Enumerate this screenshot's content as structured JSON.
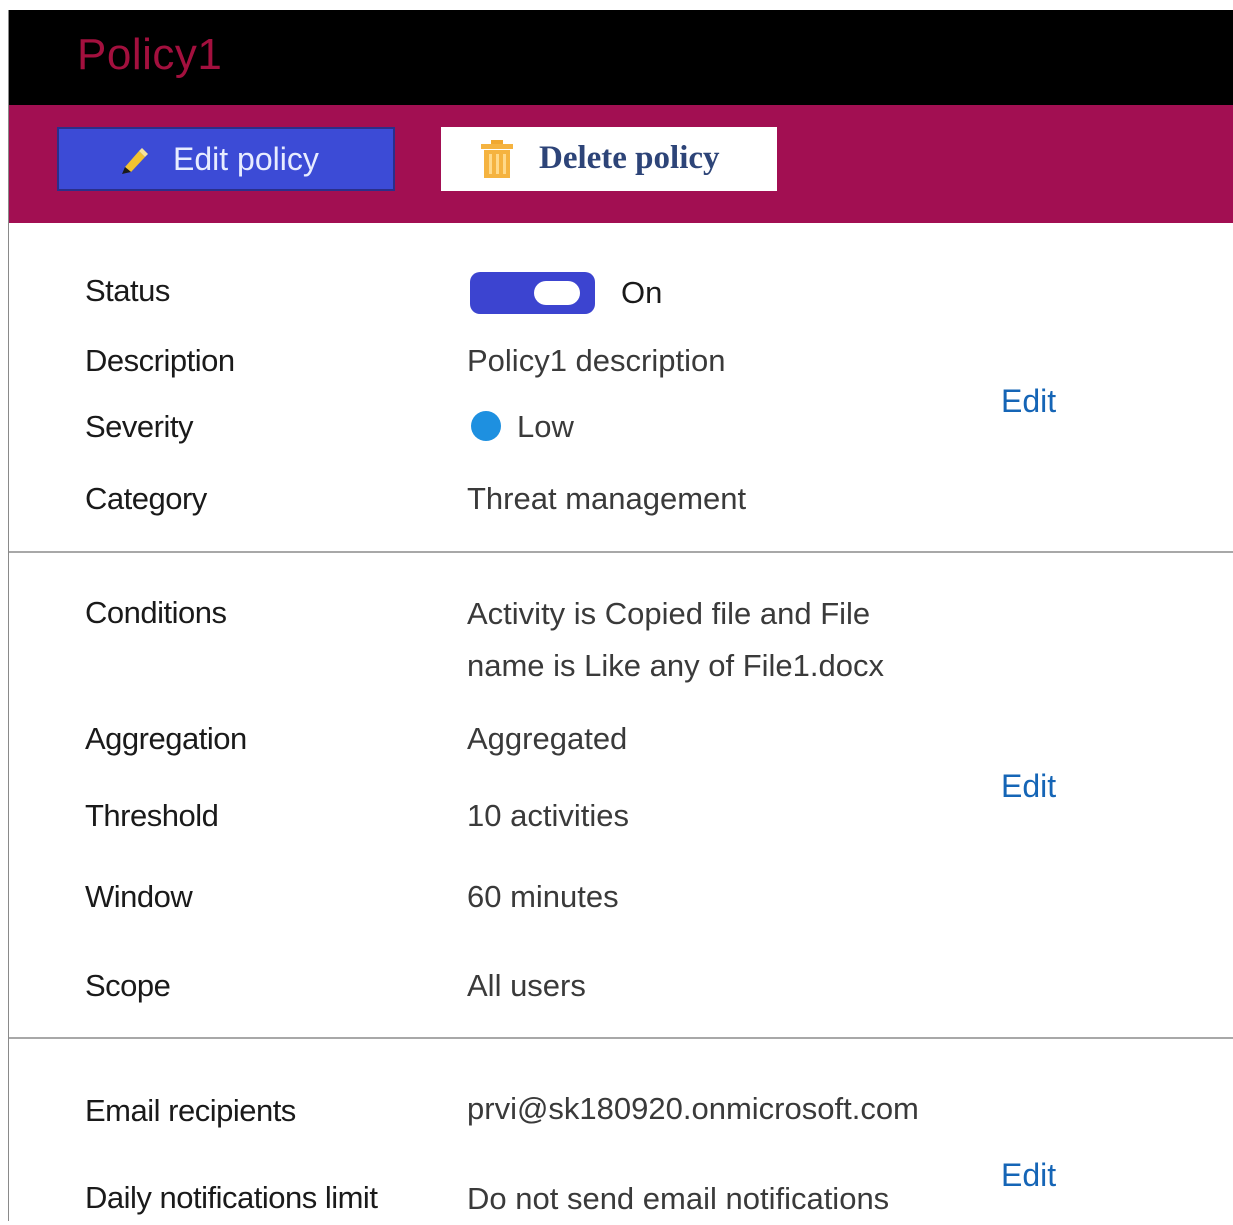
{
  "window": {
    "title": "Policy1"
  },
  "toolbar": {
    "edit_label": "Edit policy",
    "delete_label": "Delete policy"
  },
  "general": {
    "status_label": "Status",
    "status_value": "On",
    "description_label": "Description",
    "description_value": "Policy1 description",
    "severity_label": "Severity",
    "severity_value": "Low",
    "severity_color": "#1e90e0",
    "category_label": "Category",
    "category_value": "Threat management",
    "edit_label": "Edit"
  },
  "conditions": {
    "conditions_label": "Conditions",
    "conditions_line1": "Activity is Copied file and File",
    "conditions_line2": "name is Like any of File1.docx",
    "aggregation_label": "Aggregation",
    "aggregation_value": "Aggregated",
    "threshold_label": "Threshold",
    "threshold_value": "10 activities",
    "window_label": "Window",
    "window_value": "60 minutes",
    "scope_label": "Scope",
    "scope_value": "All users",
    "edit_label": "Edit"
  },
  "notifications": {
    "recipients_label": "Email recipients",
    "recipients_value": "prvi@sk180920.onmicrosoft.com",
    "limit_label": "Daily notifications limit",
    "limit_value": "Do not send email notifications",
    "edit_label": "Edit"
  },
  "colors": {
    "titlebar": "#000000",
    "title_text": "#a3103e",
    "actionbar": "#a20f52",
    "edit_button": "#3c4bd6",
    "link": "#1565b6",
    "toggle_on": "#3c44d0"
  },
  "icons": {
    "edit": "pencil-icon",
    "delete": "trash-icon"
  }
}
